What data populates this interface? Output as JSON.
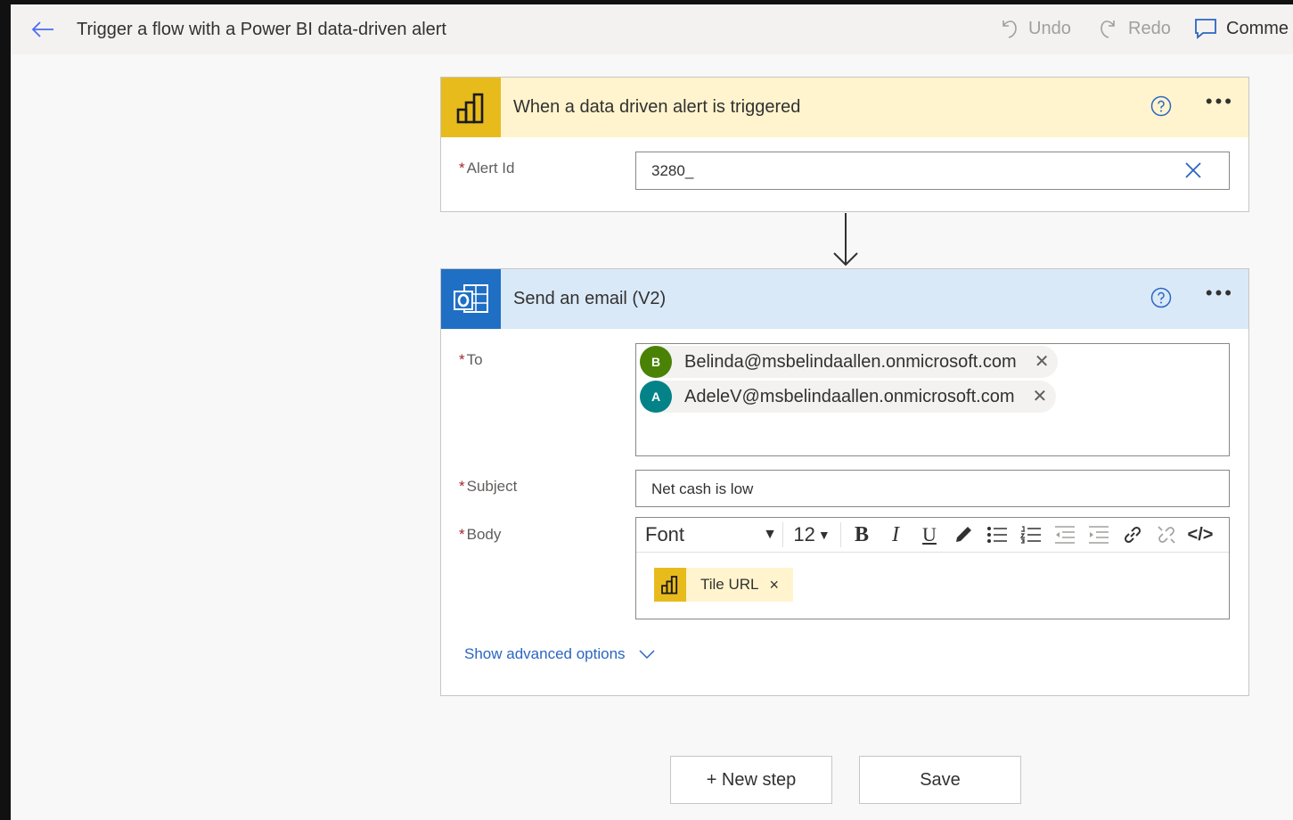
{
  "header": {
    "title": "Trigger a flow with a Power BI data-driven alert",
    "undo_label": "Undo",
    "redo_label": "Redo",
    "comments_label": "Comme"
  },
  "trigger_card": {
    "title": "When a data driven alert is triggered",
    "icon": "powerbi-icon",
    "fields": {
      "alert_id_label": "Alert Id",
      "alert_id_value": "3280_"
    }
  },
  "action_card": {
    "title": "Send an email (V2)",
    "icon": "outlook-icon",
    "to_label": "To",
    "recipients": [
      {
        "initial": "B",
        "email": "Belinda@msbelindaallen.onmicrosoft.com",
        "color": "#498205"
      },
      {
        "initial": "A",
        "email": "AdeleV@msbelindaallen.onmicrosoft.com",
        "color": "#038387"
      }
    ],
    "subject_label": "Subject",
    "subject_value": "Net cash is low",
    "body_label": "Body",
    "editor": {
      "font": "Font",
      "size": "12"
    },
    "body_token": "Tile URL",
    "advanced_label": "Show advanced options"
  },
  "footer": {
    "new_step_label": "+ New step",
    "save_label": "Save"
  },
  "colors": {
    "trigger_accent": "#e8bb1d",
    "trigger_header_bg": "#fff4ce",
    "action_accent": "#1f6fc5",
    "action_header_bg": "#dae9f8",
    "link": "#2b66c1",
    "required": "#a4262c"
  }
}
